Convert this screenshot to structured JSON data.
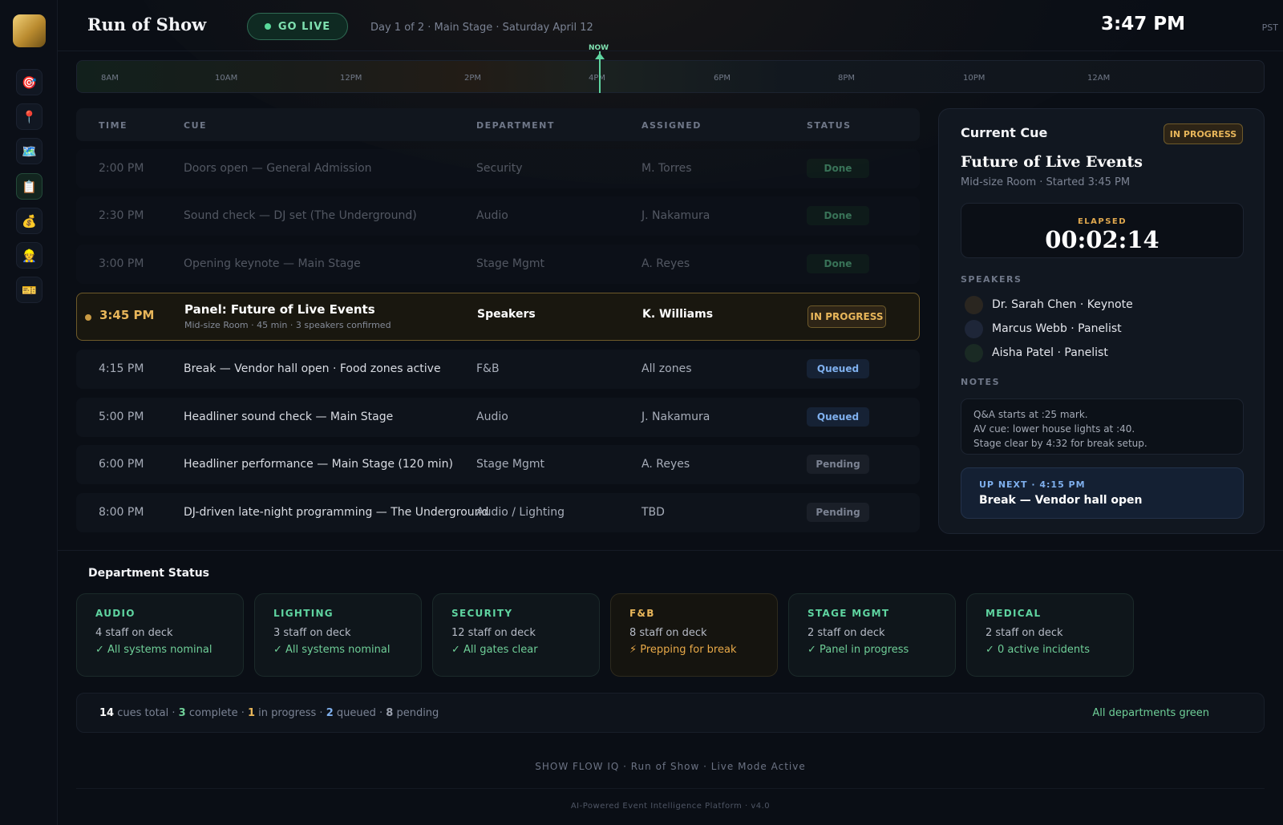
{
  "header": {
    "title": "Run of Show",
    "go_live_label": "GO LIVE",
    "subtitle": "Day 1 of 2 · Main Stage · Saturday April 12",
    "clock": "3:47 PM",
    "timezone": "PST"
  },
  "sidebar": {
    "items": [
      {
        "icon": "target-icon",
        "glyph": "🎯"
      },
      {
        "icon": "pin-icon",
        "glyph": "📍"
      },
      {
        "icon": "map-icon",
        "glyph": "🗺️"
      },
      {
        "icon": "clipboard-icon",
        "glyph": "📋",
        "active": true
      },
      {
        "icon": "money-bag-icon",
        "glyph": "💰"
      },
      {
        "icon": "worker-icon",
        "glyph": "👷"
      },
      {
        "icon": "ticket-icon",
        "glyph": "🎫"
      }
    ]
  },
  "timeline": {
    "now_label": "NOW",
    "hours": [
      "8AM",
      "10AM",
      "12PM",
      "2PM",
      "4PM",
      "6PM",
      "8PM",
      "10PM",
      "12AM"
    ]
  },
  "table": {
    "headers": {
      "time": "TIME",
      "cue": "CUE",
      "department": "DEPARTMENT",
      "assigned": "ASSIGNED",
      "status": "STATUS"
    },
    "rows": [
      {
        "time": "2:00 PM",
        "cue": "Doors open — General Admission",
        "department": "Security",
        "assigned": "M. Torres",
        "status": "Done"
      },
      {
        "time": "2:30 PM",
        "cue": "Sound check — DJ set (The Underground)",
        "department": "Audio",
        "assigned": "J. Nakamura",
        "status": "Done"
      },
      {
        "time": "3:00 PM",
        "cue": "Opening keynote — Main Stage",
        "department": "Stage Mgmt",
        "assigned": "A. Reyes",
        "status": "Done"
      },
      {
        "time": "3:45 PM",
        "cue": "Panel: Future of Live Events",
        "detail": "Mid-size Room · 45 min · 3 speakers confirmed",
        "department": "Speakers",
        "assigned": "K. Williams",
        "status": "IN PROGRESS"
      },
      {
        "time": "4:15 PM",
        "cue": "Break — Vendor hall open · Food zones active",
        "department": "F&B",
        "assigned": "All zones",
        "status": "Queued"
      },
      {
        "time": "5:00 PM",
        "cue": "Headliner sound check — Main Stage",
        "department": "Audio",
        "assigned": "J. Nakamura",
        "status": "Queued"
      },
      {
        "time": "6:00 PM",
        "cue": "Headliner performance — Main Stage (120 min)",
        "department": "Stage Mgmt",
        "assigned": "A. Reyes",
        "status": "Pending"
      },
      {
        "time": "8:00 PM",
        "cue": "DJ-driven late-night programming — The Underground",
        "department": "Audio / Lighting",
        "assigned": "TBD",
        "status": "Pending"
      }
    ]
  },
  "current_cue": {
    "heading": "Current Cue",
    "badge": "IN PROGRESS",
    "title": "Future of Live Events",
    "subtitle": "Mid-size Room · Started 3:45 PM",
    "elapsed_label": "ELAPSED",
    "elapsed": "00:02:14",
    "speakers_label": "SPEAKERS",
    "speakers": [
      {
        "name": "Dr. Sarah Chen · Keynote",
        "color": "#2a2620"
      },
      {
        "name": "Marcus Webb · Panelist",
        "color": "#1e2638"
      },
      {
        "name": "Aisha Patel · Panelist",
        "color": "#1a2a24"
      }
    ],
    "notes_label": "NOTES",
    "notes": [
      "Q&A starts at :25 mark.",
      "AV cue: lower house lights at :40.",
      "Stage clear by 4:32 for break setup."
    ],
    "up_next_label": "UP NEXT · 4:15 PM",
    "up_next_title": "Break — Vendor hall open"
  },
  "departments": {
    "heading": "Department Status",
    "items": [
      {
        "name": "AUDIO",
        "staff": "4 staff on deck",
        "status": "✓ All systems nominal",
        "color": "#5fd4a0",
        "status_color": "#6fcf98"
      },
      {
        "name": "LIGHTING",
        "staff": "3 staff on deck",
        "status": "✓ All systems nominal",
        "color": "#5fd4a0",
        "status_color": "#6fcf98"
      },
      {
        "name": "SECURITY",
        "staff": "12 staff on deck",
        "status": "✓ All gates clear",
        "color": "#5fd4a0",
        "status_color": "#6fcf98"
      },
      {
        "name": "F&B",
        "staff": "8 staff on deck",
        "status": "⚡ Prepping for break",
        "color": "#e8b65a",
        "status_color": "#e8a948",
        "warn": true
      },
      {
        "name": "STAGE MGMT",
        "staff": "2 staff on deck",
        "status": "✓ Panel in progress",
        "color": "#5fd4a0",
        "status_color": "#6fcf98"
      },
      {
        "name": "MEDICAL",
        "staff": "2 staff on deck",
        "status": "✓ 0 active incidents",
        "color": "#5fd4a0",
        "status_color": "#6fcf98"
      }
    ]
  },
  "summary": {
    "total": "14",
    "total_label": "cues total ·",
    "complete": "3",
    "complete_label": "complete ·",
    "in_progress": "1",
    "in_progress_label": "in progress ·",
    "queued": "2",
    "queued_label": "queued ·",
    "pending": "8",
    "pending_label": "pending",
    "right": "All departments green"
  },
  "footer": {
    "line1": "SHOW FLOW IQ · Run of Show · Live Mode Active",
    "line2": "AI-Powered Event Intelligence Platform · v4.0"
  }
}
